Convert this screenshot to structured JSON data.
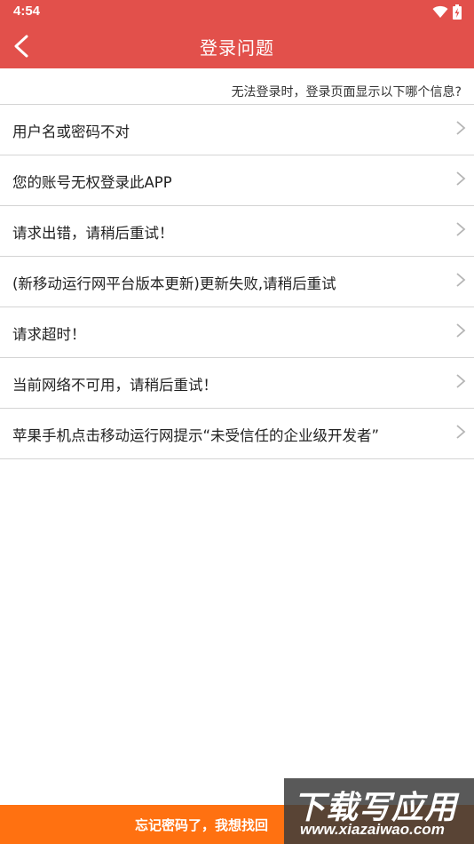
{
  "status_bar": {
    "time": "4:54",
    "wifi_icon": "wifi-icon",
    "battery_icon": "battery-charging-icon"
  },
  "app_bar": {
    "title": "登录问题",
    "back_icon": "back-arrow-icon"
  },
  "question": "无法登录时，登录页面显示以下哪个信息?",
  "items": [
    {
      "label": "用户名或密码不对"
    },
    {
      "label": "您的账号无权登录此APP"
    },
    {
      "label": "请求出错，请稍后重试！"
    },
    {
      "label": "(新移动运行网平台版本更新)更新失败,请稍后重试"
    },
    {
      "label": "请求超时！"
    },
    {
      "label": "当前网络不可用，请稍后重试！"
    },
    {
      "label": "苹果手机点击移动运行网提示“未受信任的企业级开发者”"
    }
  ],
  "bottom_bar": {
    "label": "忘记密码了，我想找回"
  },
  "watermark": {
    "title": "下载写应用",
    "url": "www.xiazaiwao.com"
  },
  "colors": {
    "primary": "#e2504b",
    "accent": "#ff7111",
    "divider": "#d4d4d4"
  }
}
